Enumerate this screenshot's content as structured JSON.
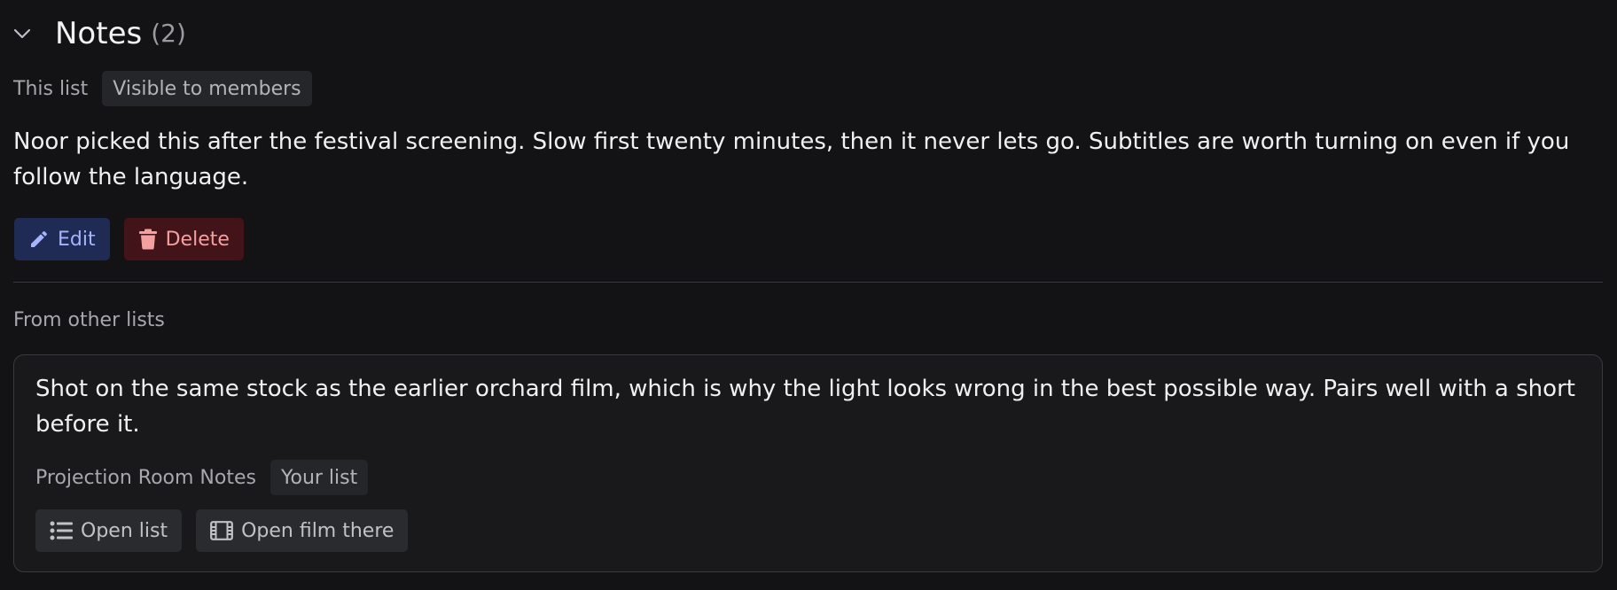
{
  "header": {
    "title": "Notes",
    "count": "(2)"
  },
  "this_list": {
    "label": "This list",
    "visibility": "Visible to members",
    "note": "Noor picked this after the festival screening. Slow first twenty minutes, then it never lets go. Subtitles are worth turning on even if you follow the language.",
    "edit_label": "Edit",
    "delete_label": "Delete"
  },
  "other_lists": {
    "label": "From other lists",
    "items": [
      {
        "note": "Shot on the same stock as the earlier orchard film, which is why the light looks wrong in the best possible way. Pairs well with a short before it.",
        "list_name": "Projection Room Notes",
        "badge": "Your list",
        "open_list_label": "Open list",
        "open_film_label": "Open film there"
      }
    ]
  },
  "icons": {
    "toggle": "chevron-down-icon",
    "edit": "pencil-icon",
    "delete": "trash-icon",
    "open_list": "list-icon",
    "open_film": "film-icon"
  },
  "colors": {
    "background": "#131315",
    "edit_bg": "#1f2a55",
    "edit_fg": "#a5b4fc",
    "delete_bg": "#42141a",
    "delete_fg": "#f5a0a0"
  }
}
